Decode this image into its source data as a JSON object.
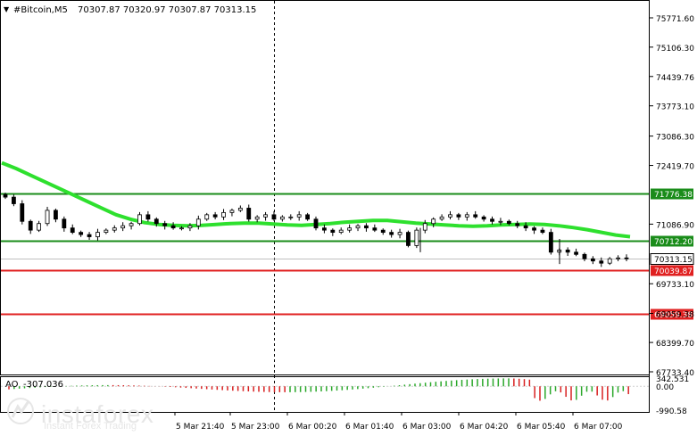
{
  "header": {
    "arrow": "▼",
    "symbol": "#Bitcoin,M5",
    "ohlc": "70307.87 70320.97 70307.87 70313.15"
  },
  "watermark": {
    "brand": "instaforex",
    "tagline": "Instant Forex Trading"
  },
  "chart_data": {
    "type": "candlestick",
    "symbol": "#Bitcoin",
    "timeframe": "M5",
    "ylim": [
      67700,
      76000
    ],
    "y_ticks": [
      "75771.60",
      "75106.30",
      "74439.76",
      "73773.10",
      "73086.30",
      "72419.70",
      "71086.90",
      "69733.10",
      "69059.38",
      "68399.70",
      "67733.40"
    ],
    "x_ticks": [
      "5 Mar 21:40",
      "5 Mar 23:00",
      "6 Mar 00:20",
      "6 Mar 01:40",
      "6 Mar 03:00",
      "6 Mar 04:20",
      "6 Mar 05:40",
      "6 Mar 07:00"
    ],
    "levels": [
      {
        "label": "71776.38",
        "value": 71776.38,
        "color": "#1a8c1a"
      },
      {
        "label": "70712.20",
        "value": 70712.2,
        "color": "#1a8c1a"
      },
      {
        "label": "70039.87",
        "value": 70039.87,
        "color": "#e02020"
      },
      {
        "label": "69059.38",
        "value": 69059.38,
        "color": "#e02020"
      }
    ],
    "current_price": {
      "label": "70313.15",
      "value": 70313.15
    },
    "moving_average": {
      "color": "#2ee02e",
      "values": [
        72480,
        72350,
        72200,
        72050,
        71900,
        71750,
        71600,
        71450,
        71300,
        71200,
        71120,
        71080,
        71060,
        71050,
        71060,
        71080,
        71100,
        71110,
        71110,
        71090,
        71070,
        71060,
        71080,
        71100,
        71130,
        71150,
        71170,
        71170,
        71140,
        71110,
        71090,
        71070,
        71050,
        71040,
        71050,
        71070,
        71080,
        71090,
        71080,
        71050,
        71010,
        70960,
        70900,
        70840,
        70800
      ]
    },
    "closes": [
      71700,
      71550,
      71150,
      70950,
      71100,
      71400,
      71200,
      71000,
      70900,
      70850,
      70800,
      70900,
      70950,
      71000,
      71050,
      71100,
      71300,
      71200,
      71100,
      71050,
      71000,
      71000,
      71050,
      71200,
      71300,
      71250,
      71350,
      71400,
      71450,
      71200,
      71250,
      71300,
      71200,
      71250,
      71250,
      71300,
      71200,
      71000,
      70950,
      70900,
      70950,
      71000,
      71050,
      71000,
      70950,
      70900,
      70850,
      70900,
      70600,
      70950,
      71100,
      71200,
      71250,
      71300,
      71250,
      71300,
      71250,
      71200,
      71150,
      71150,
      71100,
      71050,
      71000,
      70950,
      70900,
      70450,
      70500,
      70450,
      70400,
      70300,
      70250,
      70200,
      70300,
      70320,
      70313
    ],
    "indicator": {
      "name": "AO",
      "value": "-307.036",
      "y_ticks": [
        "342.531",
        "0.00",
        "-990.58"
      ],
      "ylim": [
        -990.58,
        342.531
      ]
    }
  }
}
